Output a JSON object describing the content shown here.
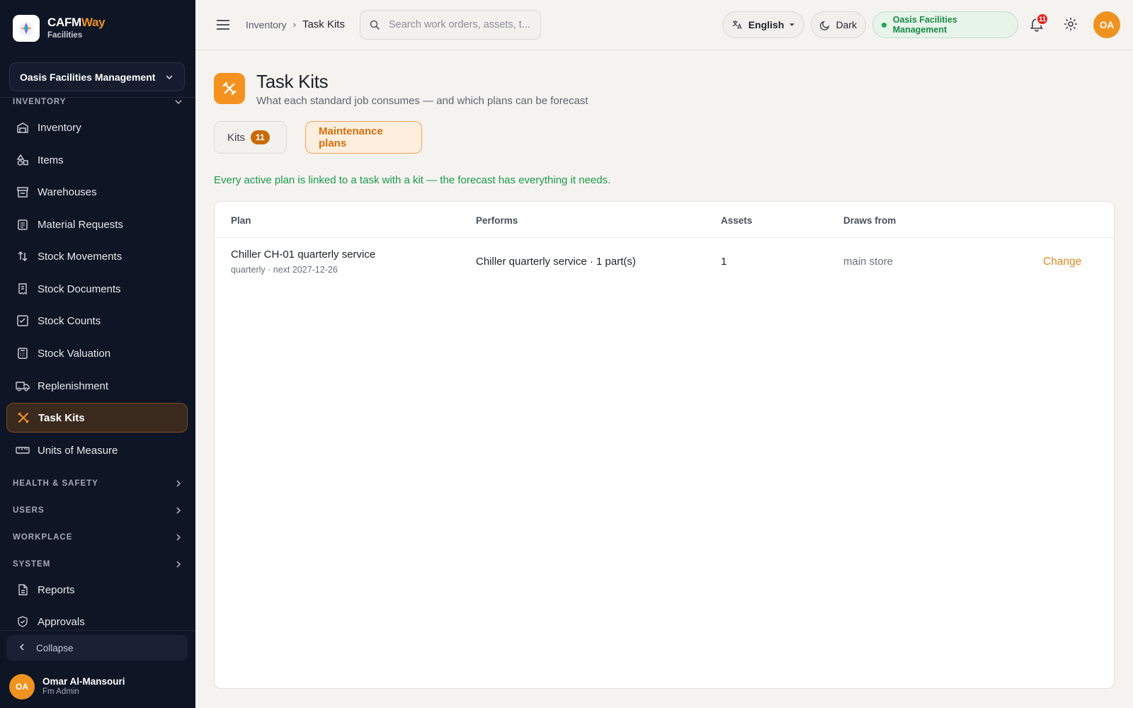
{
  "brand": {
    "name_main": "CAFM",
    "name_accent": "Way",
    "subtitle": "Facilities"
  },
  "sidebar": {
    "org_selector": "Oasis Facilities Management",
    "section_inventory": "INVENTORY",
    "items": [
      {
        "label": "Inventory",
        "icon": "warehouse-icon"
      },
      {
        "label": "Items",
        "icon": "shapes-icon"
      },
      {
        "label": "Warehouses",
        "icon": "store-icon"
      },
      {
        "label": "Material Requests",
        "icon": "clipboard-icon"
      },
      {
        "label": "Stock Movements",
        "icon": "arrows-updown-icon"
      },
      {
        "label": "Stock Documents",
        "icon": "receipt-icon"
      },
      {
        "label": "Stock Counts",
        "icon": "checklist-icon"
      },
      {
        "label": "Stock Valuation",
        "icon": "calculator-icon"
      },
      {
        "label": "Replenishment",
        "icon": "truck-icon"
      },
      {
        "label": "Task Kits",
        "icon": "tools-icon",
        "active": true
      },
      {
        "label": "Units of Measure",
        "icon": "ruler-icon"
      }
    ],
    "sections": [
      "HEALTH & SAFETY",
      "USERS",
      "WORKPLACE",
      "SYSTEM"
    ],
    "bottom_items": [
      {
        "label": "Reports",
        "icon": "report-icon"
      },
      {
        "label": "Approvals",
        "icon": "shield-check-icon"
      }
    ],
    "collapse_label": "Collapse",
    "user": {
      "initials": "OA",
      "name": "Omar Al-Mansouri",
      "role": "Fm Admin"
    }
  },
  "topbar": {
    "breadcrumb_parent": "Inventory",
    "breadcrumb_current": "Task Kits",
    "search_placeholder": "Search work orders, assets, t...",
    "language": "English",
    "theme_label": "Dark",
    "org_badge": "Oasis Facilities Management",
    "notification_count": "11",
    "avatar_initials": "OA"
  },
  "page": {
    "title": "Task Kits",
    "subtitle": "What each standard job consumes — and which plans can be forecast",
    "tabs": {
      "kits_label": "Kits",
      "kits_count": "11",
      "plans_label": "Maintenance plans"
    },
    "notice": "Every active plan is linked to a task with a kit — the forecast has everything it needs."
  },
  "table": {
    "headers": {
      "plan": "Plan",
      "performs": "Performs",
      "assets": "Assets",
      "draws_from": "Draws from"
    },
    "rows": [
      {
        "plan": "Chiller CH-01 quarterly service",
        "plan_meta": "quarterly · next 2027-12-26",
        "performs": "Chiller quarterly service · 1 part(s)",
        "assets": "1",
        "draws_from": "main store",
        "action": "Change"
      }
    ]
  },
  "colors": {
    "accent": "#f0921f",
    "sidebar_bg": "#0e1525",
    "success": "#1a9a4a"
  }
}
